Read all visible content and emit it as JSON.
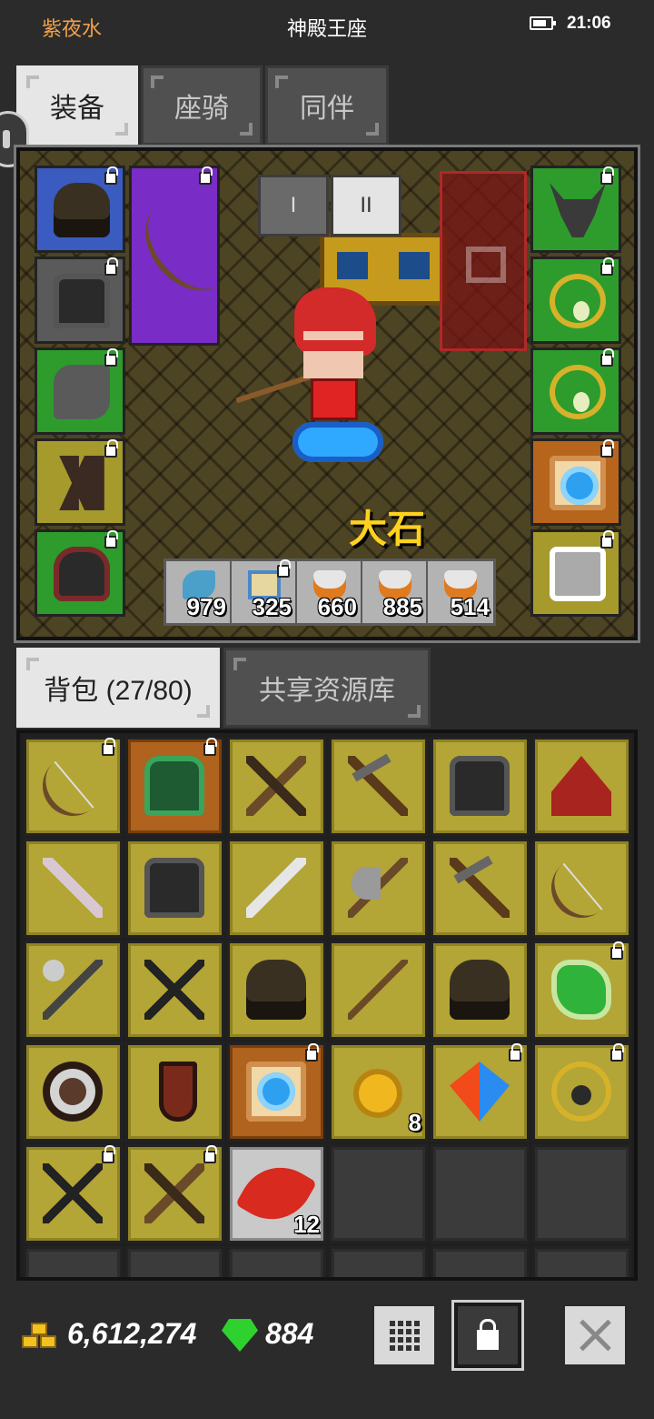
{
  "status_bar": {
    "player_name": "紫夜水",
    "location": "神殿王座",
    "battery_level": 0.75,
    "time": "21:06"
  },
  "tabs": {
    "equipment": "装备",
    "mount": "座骑",
    "companion": "同伴",
    "active": "装备"
  },
  "scene": {
    "page_toggle": [
      "I",
      "II"
    ],
    "active_page": "II",
    "character_name": "大石"
  },
  "equip_left": [
    {
      "icon": "hood-helmet-icon",
      "rarity": "blue",
      "locked": true
    },
    {
      "icon": "chest-armor-icon",
      "rarity": "grey",
      "locked": true
    },
    {
      "icon": "gauntlet-icon",
      "rarity": "green",
      "locked": true
    },
    {
      "icon": "greaves-icon",
      "rarity": "gold",
      "locked": true
    },
    {
      "icon": "boots-icon",
      "rarity": "green",
      "locked": true
    }
  ],
  "equip_weapon": {
    "icon": "bow-icon",
    "rarity": "purple",
    "locked": true
  },
  "equip_right": [
    {
      "icon": "horned-helmet-icon",
      "rarity": "green",
      "locked": true
    },
    {
      "icon": "ring-icon",
      "rarity": "green",
      "locked": true
    },
    {
      "icon": "ring-icon",
      "rarity": "green",
      "locked": true
    },
    {
      "icon": "scroll-icon",
      "rarity": "orange",
      "locked": true
    },
    {
      "icon": "pet-cat-icon",
      "rarity": "gold",
      "locked": true
    }
  ],
  "consumables": [
    {
      "icon": "fish-icon",
      "count": "979",
      "locked": false
    },
    {
      "icon": "book-icon",
      "count": "325",
      "locked": true
    },
    {
      "icon": "potion-icon",
      "count": "660",
      "locked": false
    },
    {
      "icon": "potion-icon",
      "count": "885",
      "locked": false
    },
    {
      "icon": "potion-icon",
      "count": "514",
      "locked": false
    }
  ],
  "inventory_tabs": {
    "backpack": "背包 (27/80)",
    "shared_storage": "共享资源库",
    "active": "背包 (27/80)"
  },
  "inventory": [
    {
      "icon": "bow-icon",
      "rarity": "gold",
      "locked": true
    },
    {
      "icon": "green-armor-icon",
      "rarity": "orange",
      "locked": true
    },
    {
      "icon": "crossbow-icon",
      "rarity": "gold",
      "locked": false
    },
    {
      "icon": "pickaxe-icon",
      "rarity": "gold",
      "locked": false
    },
    {
      "icon": "chest-armor-icon",
      "rarity": "gold",
      "locked": false
    },
    {
      "icon": "red-helmet-icon",
      "rarity": "gold",
      "locked": false
    },
    {
      "icon": "dagger-icon",
      "rarity": "gold",
      "locked": false
    },
    {
      "icon": "chest-armor-icon",
      "rarity": "gold",
      "locked": false
    },
    {
      "icon": "sword-icon",
      "rarity": "gold",
      "locked": false
    },
    {
      "icon": "axe-icon",
      "rarity": "gold",
      "locked": false
    },
    {
      "icon": "pickaxe-icon",
      "rarity": "gold",
      "locked": false
    },
    {
      "icon": "bow-icon",
      "rarity": "gold",
      "locked": false
    },
    {
      "icon": "mace-icon",
      "rarity": "gold",
      "locked": false
    },
    {
      "icon": "crossed-spears-icon",
      "rarity": "gold",
      "locked": false
    },
    {
      "icon": "hood-icon",
      "rarity": "gold",
      "locked": false
    },
    {
      "icon": "staff-icon",
      "rarity": "gold",
      "locked": false
    },
    {
      "icon": "hood-icon",
      "rarity": "gold",
      "locked": false
    },
    {
      "icon": "green-scroll-icon",
      "rarity": "gold",
      "locked": true
    },
    {
      "icon": "round-shield-icon",
      "rarity": "gold",
      "locked": false
    },
    {
      "icon": "tower-shield-icon",
      "rarity": "gold",
      "locked": false
    },
    {
      "icon": "blue-scroll-icon",
      "rarity": "orange",
      "locked": true
    },
    {
      "icon": "gold-coin-icon",
      "rarity": "gold",
      "locked": false,
      "count": "8"
    },
    {
      "icon": "gem-icon",
      "rarity": "gold",
      "locked": true
    },
    {
      "icon": "amulet-icon",
      "rarity": "gold",
      "locked": true
    },
    {
      "icon": "crossed-spears-icon",
      "rarity": "gold",
      "locked": true
    },
    {
      "icon": "crossbow-icon",
      "rarity": "gold",
      "locked": true
    },
    {
      "icon": "red-feather-icon",
      "rarity": "light",
      "locked": false,
      "count": "12"
    },
    {
      "icon": "",
      "rarity": "empty",
      "locked": false
    },
    {
      "icon": "",
      "rarity": "empty",
      "locked": false
    },
    {
      "icon": "",
      "rarity": "empty",
      "locked": false
    },
    {
      "icon": "",
      "rarity": "empty",
      "locked": false
    },
    {
      "icon": "",
      "rarity": "empty",
      "locked": false
    },
    {
      "icon": "",
      "rarity": "empty",
      "locked": false
    },
    {
      "icon": "",
      "rarity": "empty",
      "locked": false
    },
    {
      "icon": "",
      "rarity": "empty",
      "locked": false
    },
    {
      "icon": "",
      "rarity": "empty",
      "locked": false
    }
  ],
  "bottom_bar": {
    "gold": "6,612,274",
    "diamonds": "884"
  }
}
